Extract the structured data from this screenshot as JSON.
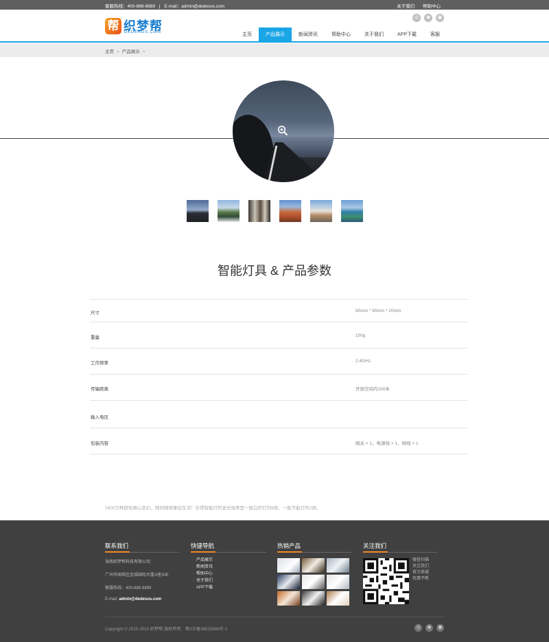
{
  "topbar": {
    "hotline": "客服热线：400-888-8889",
    "divider": "|",
    "email": "E-mail：admin@dedesos.com",
    "links": [
      "关于我们",
      "帮助中心"
    ]
  },
  "logo": {
    "mark": "帮",
    "name": "织梦帮",
    "domain": "DEDESOS.COM"
  },
  "header_icons": [
    "weibo-icon",
    "wechat-icon",
    "cart-icon"
  ],
  "nav": {
    "items": [
      "主页",
      "产品展示",
      "新闻资讯",
      "帮助中心",
      "关于我们",
      "APP下载",
      "客服"
    ],
    "active_index": 1
  },
  "breadcrumb": {
    "items": [
      "主页",
      "产品展示"
    ],
    "sep": ">"
  },
  "product": {
    "title": "智能灯具 & 产品参数",
    "specs": [
      {
        "label": "尺寸",
        "value": "90mm * 90mm * 20mm"
      },
      {
        "label": "重量",
        "value": "100g"
      },
      {
        "label": "工作频率",
        "value": "2.4GHz"
      },
      {
        "label": "传输距离",
        "value": "开放空间内150米"
      },
      {
        "label": "输入电压",
        "value": ""
      },
      {
        "label": "包装内容",
        "value": "网关 × 1，电源线 × 1，网线 × 1"
      }
    ],
    "description": "1600万种颜色随心变幻，随时随地掌控生活！乐得智能灯的发光效率是一般白炽灯的8倍，一般节能灯的2倍。"
  },
  "footer": {
    "contact": {
      "title": "联系我们",
      "company": "海南织梦帮科技有限公司",
      "address": "广州市国宾区金城国际大厦A座30E",
      "hotline": "客服热线：400-888-8889",
      "email_label": "E-mail:",
      "email": "admin@dedesos.com"
    },
    "quicknav": {
      "title": "快捷导航",
      "links": [
        "产品展示",
        "新闻资讯",
        "帮助中心",
        "关于我们",
        "APP下载"
      ]
    },
    "hot": {
      "title": "热销产品"
    },
    "follow": {
      "title": "关注我们",
      "lines": [
        "微信扫描",
        "关注我们",
        "官方商城",
        "优惠不断"
      ]
    },
    "copyright": [
      "Copyright © 2015-2015 织梦帮 版权所有",
      "粤ICP备36525698号-1"
    ],
    "icons": [
      "weibo-icon",
      "wechat-icon",
      "cart-icon"
    ]
  }
}
